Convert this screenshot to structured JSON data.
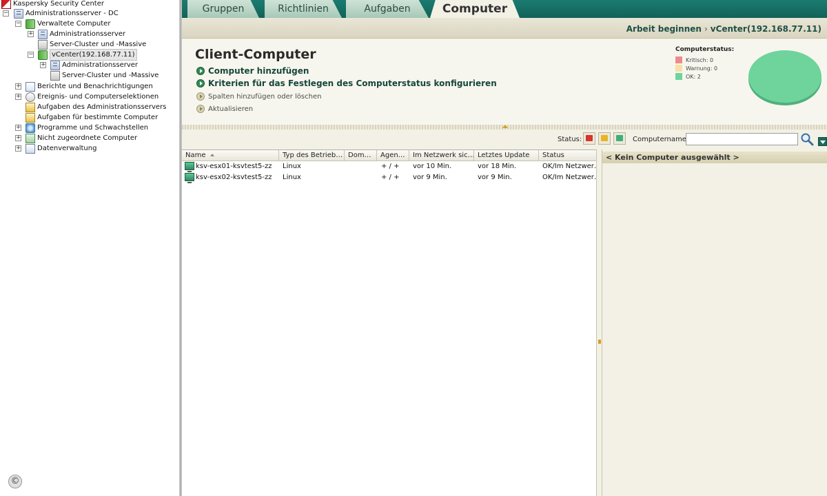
{
  "tree": {
    "root": "Kaspersky Security Center",
    "server": "Administrationsserver - DC",
    "managed": "Verwaltete Computer",
    "admin_server": "Administrationsserver",
    "cluster": "Server-Cluster und -Massive",
    "vcenter": "vCenter(192.168.77.11)",
    "vc_admin_server": "Administrationsserver",
    "vc_cluster": "Server-Cluster und -Massive",
    "reports": "Berichte und Benachrichtigungen",
    "events": "Ereignis- und Computerselektionen",
    "admin_tasks": "Aufgaben des Administrationsservers",
    "computer_tasks": "Aufgaben für bestimmte Computer",
    "programs": "Programme und Schwachstellen",
    "unassigned": "Nicht zugeordnete Computer",
    "data": "Datenverwaltung"
  },
  "tabs": [
    "Gruppen",
    "Richtlinien",
    "Aufgaben",
    "Computer"
  ],
  "breadcrumb": {
    "first": "Arbeit beginnen",
    "separator": "›",
    "current": "vCenter(192.168.77.11)"
  },
  "header": {
    "title": "Client-Computer",
    "actions": [
      "Computer hinzufügen",
      "Kriterien für das Festlegen des Computerstatus konfigurieren",
      "Spalten hinzufügen oder löschen",
      "Aktualisieren"
    ]
  },
  "computer_status": {
    "title": "Computerstatus:",
    "legend": [
      {
        "label": "Kritisch: 0",
        "color": "#f08a8a",
        "value": 0
      },
      {
        "label": "Warnung: 0",
        "color": "#f6e0a8",
        "value": 0
      },
      {
        "label": "OK: 2",
        "color": "#6fd39c",
        "value": 2
      }
    ]
  },
  "filter": {
    "status_label": "Status:",
    "computer_name_label": "Computername:",
    "computer_name_value": "",
    "computer_name_placeholder": ""
  },
  "table": {
    "columns": [
      "Name",
      "Typ des Betrieb…",
      "Dom…",
      "Agen…",
      "Im Netzwerk sic…",
      "Letztes Update",
      "Status"
    ],
    "rows": [
      [
        "ksv-esx01-ksvtest5-zz",
        "Linux",
        "",
        "+ / +",
        "vor 10 Min.",
        "vor 18 Min.",
        "OK/Im Netzwer…"
      ],
      [
        "ksv-esx02-ksvtest5-zz",
        "Linux",
        "",
        "+ / +",
        "vor 9 Min.",
        "vor 9 Min.",
        "OK/Im Netzwer…"
      ]
    ]
  },
  "detail": {
    "header": "< Kein Computer ausgewählt >"
  },
  "footer": {
    "copyright": "©"
  },
  "colors": {
    "accent": "#136259",
    "ok": "#6fd39c",
    "critical": "#d9352d",
    "warning": "#e8b424"
  }
}
